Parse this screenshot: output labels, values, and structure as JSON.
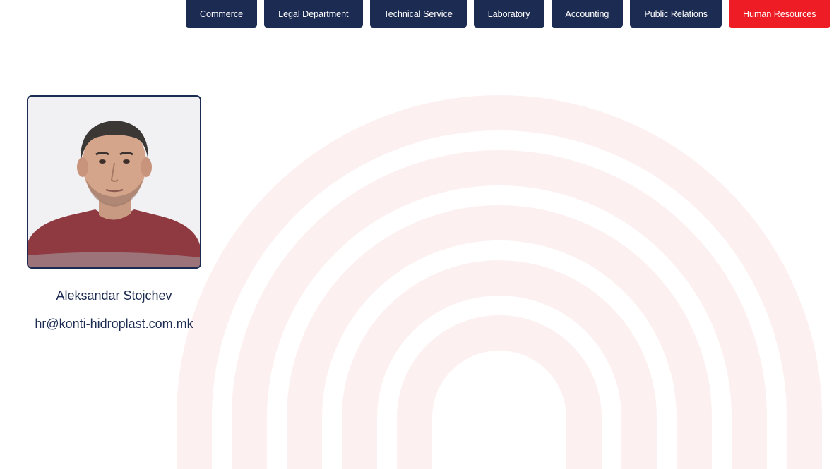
{
  "departments": [
    {
      "label": "Commerce"
    },
    {
      "label": "Legal Department"
    },
    {
      "label": "Technical Service"
    },
    {
      "label": "Laboratory"
    },
    {
      "label": "Accounting"
    },
    {
      "label": "Public Relations"
    },
    {
      "label": "Human Resources",
      "active": true
    }
  ],
  "colors": {
    "tab_bg": "#1c2b52",
    "tab_active_bg": "#ee1c25",
    "arch_tint": "#fdf0f0",
    "text": "#1c2b52"
  },
  "staff": {
    "name": "Aleksandar Stojchev",
    "email": "hr@konti-hidroplast.com.mk"
  }
}
